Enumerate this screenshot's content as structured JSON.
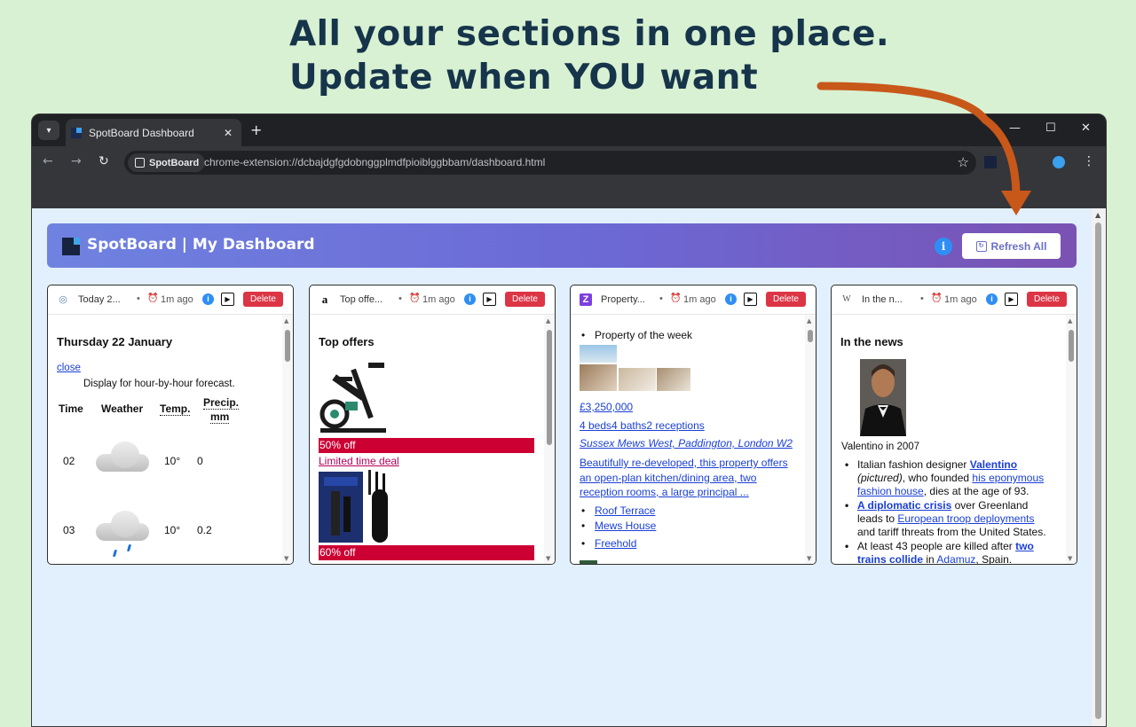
{
  "headline": {
    "line1": "All your sections in one place.",
    "line2": "Update when YOU want"
  },
  "browser": {
    "tab_title": "SpotBoard Dashboard",
    "close_tab": "✕",
    "new_tab": "+",
    "minimize": "—",
    "maximize": "☐",
    "close_window": "✕",
    "chip_label": "SpotBoard",
    "url": "chrome-extension://dcbajdgfgdobnggplmdfpioiblggbbam/dashboard.html",
    "back": "←",
    "forward": "→",
    "reload": "↻",
    "star": "☆",
    "menu": "⋮"
  },
  "header": {
    "brand": "SpotBoard |  My Dashboard",
    "info": "i",
    "refresh_label": "Refresh All"
  },
  "colors": {
    "accent": "#6c68d4",
    "delete": "#dc3545",
    "offer": "#cc0033",
    "link": "#1a3fd6",
    "arrow": "#c8571a"
  },
  "cards": [
    {
      "title": "Today 2...",
      "dot": "•",
      "ago": "1m ago",
      "info": "i",
      "play": "▶",
      "delete": "Delete",
      "icon": "globe-icon"
    },
    {
      "title": "Top offe...",
      "dot": "•",
      "ago": "1m ago",
      "info": "i",
      "play": "▶",
      "delete": "Delete",
      "icon": "amazon-icon"
    },
    {
      "title": "Property...",
      "dot": "•",
      "ago": "1m ago",
      "info": "i",
      "play": "▶",
      "delete": "Delete",
      "icon": "zoopla-icon"
    },
    {
      "title": "In the n...",
      "dot": "•",
      "ago": "1m ago",
      "info": "i",
      "play": "▶",
      "delete": "Delete",
      "icon": "wikipedia-icon"
    }
  ],
  "weather": {
    "date": "Thursday 22 January",
    "close": "close",
    "hint": "Display for hour-by-hour forecast.",
    "headers": [
      "Time",
      "Weather",
      "Temp.",
      "Precip.",
      "mm"
    ],
    "rows": [
      {
        "time": "02",
        "temp": "10°",
        "precip": "0",
        "icon": "cloud-icon"
      },
      {
        "time": "03",
        "temp": "10°",
        "precip": "0.2",
        "icon": "rain-cloud-icon"
      }
    ]
  },
  "offers": {
    "heading": "Top offers",
    "items": [
      {
        "badge": "50% off",
        "link": "Limited time deal",
        "image": "exercise-bike-image"
      },
      {
        "badge": "60% off",
        "image": "electric-toothbrush-image"
      }
    ]
  },
  "property": {
    "bullet": "Property of the week",
    "price": "£3,250,000",
    "rooms": "4 beds4 baths2 receptions",
    "address": "Sussex Mews West, Paddington, London W2",
    "description": "Beautifully re-developed, this property offers an open-plan kitchen/dining area, two reception rooms, a large principal ...",
    "features": [
      "Roof Terrace",
      "Mews House",
      "Freehold"
    ]
  },
  "news": {
    "heading": "In the news",
    "caption": "Valentino in 2007",
    "items": [
      {
        "p1": "Italian fashion designer ",
        "l1": "Valentino",
        "p2": " ",
        "i1": "(pictured)",
        "p3": ", who founded ",
        "l2": "his eponymous fashion house",
        "p4": ", dies at the age of 93."
      },
      {
        "l1": "A diplomatic crisis",
        "p1": " over Greenland leads to ",
        "l2": "European troop deployments",
        "p2": " and tariff threats from the United States."
      },
      {
        "p1": "At least 43 people are killed after ",
        "l1": "two trains collide",
        "p2": " in ",
        "l2": "Adamuz",
        "p3": ", Spain."
      }
    ]
  }
}
